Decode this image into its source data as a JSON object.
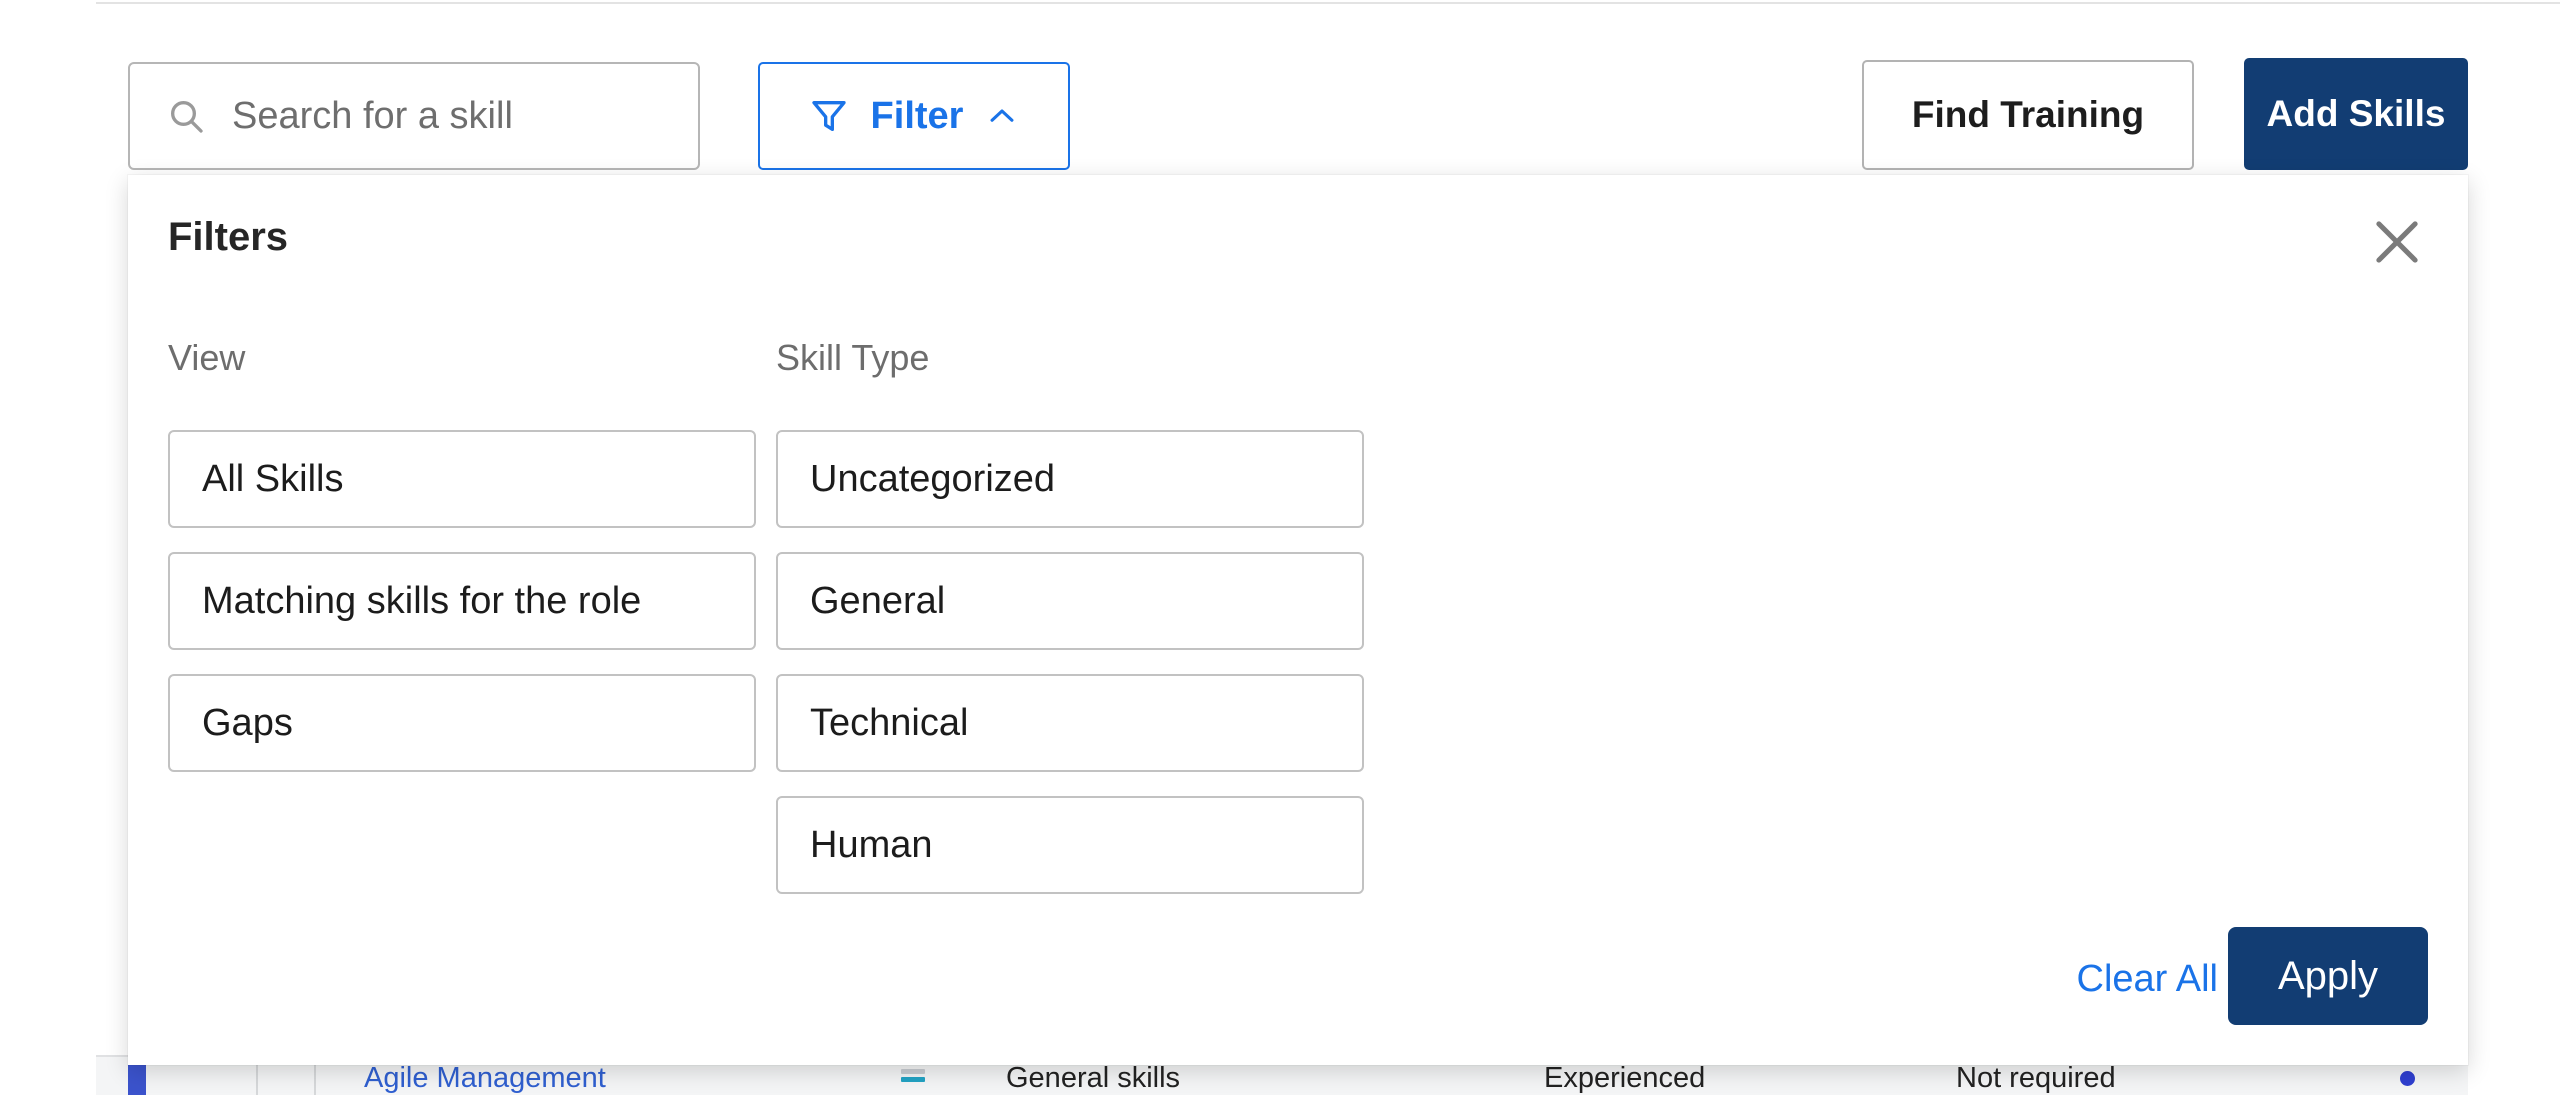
{
  "toolbar": {
    "search": {
      "placeholder": "Search for a skill",
      "value": "",
      "icon": "search-icon"
    },
    "filter_button": {
      "label": "Filter",
      "icon": "funnel-icon",
      "chevron": "chevron-up-icon",
      "expanded": true,
      "accent_color": "#1a73e8"
    },
    "find_training_label": "Find Training",
    "add_skills_label": "Add Skills"
  },
  "filters_panel": {
    "title": "Filters",
    "close_icon": "close-icon",
    "groups": [
      {
        "heading": "View",
        "options": [
          {
            "label": "All Skills",
            "selected": false
          },
          {
            "label": "Matching skills for the role",
            "selected": false
          },
          {
            "label": "Gaps",
            "selected": false
          }
        ]
      },
      {
        "heading": "Skill Type",
        "options": [
          {
            "label": "Uncategorized",
            "selected": false
          },
          {
            "label": "General",
            "selected": false
          },
          {
            "label": "Technical",
            "selected": false
          },
          {
            "label": "Human",
            "selected": false
          }
        ]
      }
    ],
    "footer": {
      "clear_all_label": "Clear All",
      "apply_label": "Apply"
    }
  },
  "background_table": {
    "row": {
      "skill_name": "Agile Management",
      "skill_type": "General skills",
      "proficiency": "Experienced",
      "requirement": "Not required",
      "proficiency_icon": "level-bars-icon",
      "status_dot": "blue-dot-icon"
    }
  },
  "colors": {
    "primary_navy": "#123d73",
    "link_blue": "#1a73e8",
    "border_gray": "#c2c2c2",
    "text_dark": "#1c1c1c",
    "muted_gray": "#6d6d6d"
  }
}
